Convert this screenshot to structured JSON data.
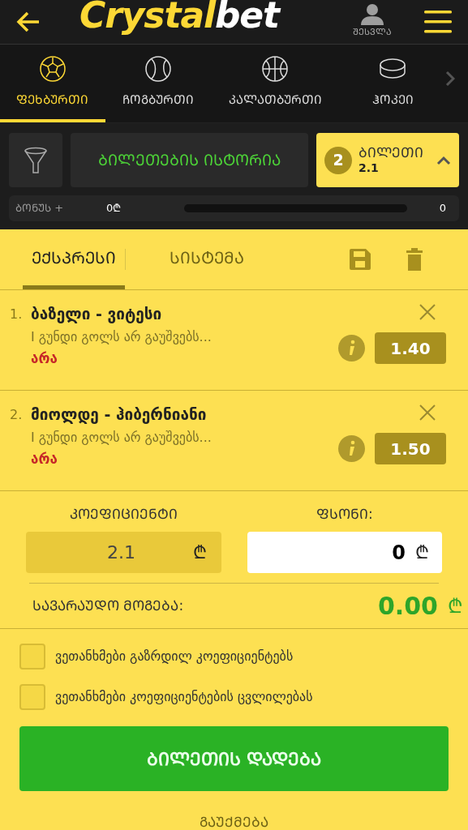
{
  "header": {
    "logo": {
      "part_1": "Crystal",
      "part_2": "bet"
    },
    "login": "ᲨᲔᲡᲕᲚᲐ"
  },
  "sports": [
    {
      "label": "ᲤᲔᲮᲑᲣᲠᲗᲘ",
      "kind": "soccer",
      "selected": true
    },
    {
      "label": "ᲩᲝᲒᲑᲣᲠᲗᲘ",
      "kind": "tennis",
      "selected": false
    },
    {
      "label": "ᲙᲐᲚᲐᲗᲑᲣᲠᲗᲘ",
      "kind": "basketball",
      "selected": false
    },
    {
      "label": "ᲰᲝᲙᲔᲘ",
      "kind": "hockey",
      "selected": false
    }
  ],
  "history_button": "ᲑᲘᲚᲔᲗᲔᲑᲘᲡ ᲘᲡᲢᲝᲠᲘᲐ",
  "ticket": {
    "count": "2",
    "label": "ᲑᲘᲚᲔᲗᲘ",
    "odds": "2.1"
  },
  "bonus": {
    "label": "ᲑᲝᲜᲣᲡ +",
    "amount": "0₾",
    "level": 0,
    "reading": "0"
  },
  "bet_tabs": [
    {
      "label": "ᲔᲥᲡᲞᲠᲔᲡᲘ",
      "selected": true
    },
    {
      "label": "ᲡᲘᲡᲢᲔᲛᲐ",
      "selected": false
    }
  ],
  "bets": [
    {
      "number": "1.",
      "match": "ბაზელი - ვიტესი",
      "market": "I გუნდი გოლს არ გაუშვებს...",
      "pick": "არა",
      "odds": "1.40"
    },
    {
      "number": "2.",
      "match": "მიოლდე - ჰიბერნიანი",
      "market": "I გუნდი გოლს არ გაუშვებს...",
      "pick": "არა",
      "odds": "1.50"
    }
  ],
  "coefficient": {
    "label": "ᲙᲝᲔᲤᲘᲪᲘᲔᲜᲢᲘ",
    "value": "2.1",
    "currency": "₾"
  },
  "stake": {
    "label": "ᲤᲡᲝᲜᲘ:",
    "value": "0",
    "currency": "₾"
  },
  "possible_win": {
    "label": "ᲡᲐᲕᲐᲠᲐᲣᲓᲝ ᲛᲝᲒᲔᲑᲐ:",
    "value": "0.00",
    "currency": "₾"
  },
  "agreements": [
    {
      "label": "ვეთანხმები გაზრდილ კოეფიციენტებს",
      "checked": false
    },
    {
      "label": "ვეთანხმები კოეფიციენტების ცვლილებას",
      "checked": false
    }
  ],
  "place_button": "ᲑᲘᲚᲔᲗᲘᲡ ᲓᲐᲓᲔᲑᲐ",
  "cancel": "ᲒᲐᲣᲥᲛᲔᲑᲐ"
}
